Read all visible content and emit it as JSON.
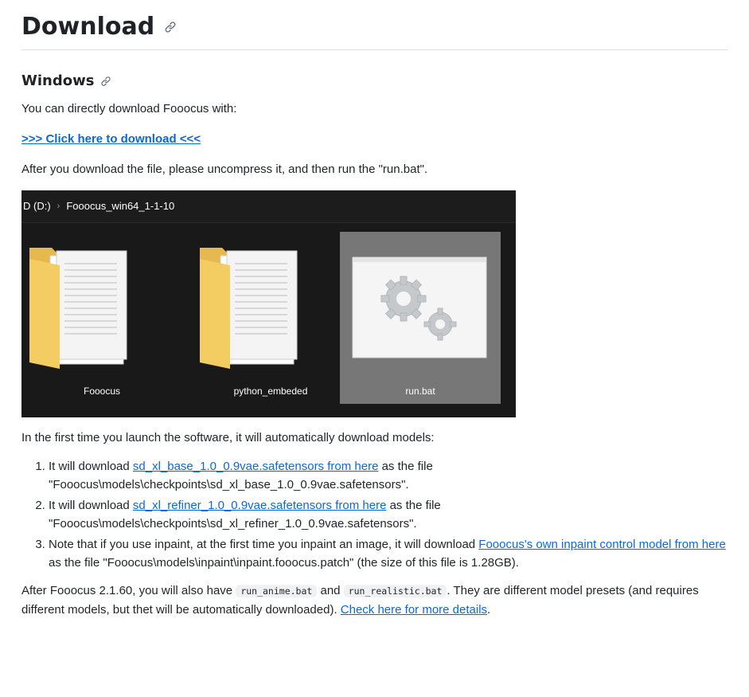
{
  "heading": {
    "title": "Download"
  },
  "windows": {
    "title": "Windows"
  },
  "intro": "You can directly download Fooocus with:",
  "download_link": ">>> Click here to download <<<",
  "after_download": "After you download the file, please uncompress it, and then run the \"run.bat\".",
  "explorer": {
    "drive": "D (D:)",
    "separator": "›",
    "folder": "Fooocus_win64_1-1-10",
    "items": [
      {
        "label": "Fooocus",
        "icon": "folder-icon"
      },
      {
        "label": "python_embeded",
        "icon": "folder-icon"
      },
      {
        "label": "run.bat",
        "icon": "batch-file-icon"
      }
    ]
  },
  "first_time": "In the first time you launch the software, it will automatically download models:",
  "steps": [
    {
      "pre": "It will download ",
      "link": "sd_xl_base_1.0_0.9vae.safetensors from here",
      "post": " as the file \"Fooocus\\models\\checkpoints\\sd_xl_base_1.0_0.9vae.safetensors\"."
    },
    {
      "pre": "It will download ",
      "link": "sd_xl_refiner_1.0_0.9vae.safetensors from here",
      "post": " as the file \"Fooocus\\models\\checkpoints\\sd_xl_refiner_1.0_0.9vae.safetensors\"."
    },
    {
      "pre": "Note that if you use inpaint, at the first time you inpaint an image, it will download ",
      "link": "Fooocus's own inpaint control model from here",
      "post": " as the file \"Fooocus\\models\\inpaint\\inpaint.fooocus.patch\" (the size of this file is 1.28GB)."
    }
  ],
  "presets": {
    "pre": "After Fooocus 2.1.60, you will also have ",
    "code1": "run_anime.bat",
    "mid": " and ",
    "code2": "run_realistic.bat",
    "post": ". They are different model presets (and requires different models, but thet will be automatically downloaded). ",
    "link": "Check here for more details",
    "end": "."
  },
  "colors": {
    "link": "#0969da",
    "text": "#1f2328",
    "explorer_bg": "#191919",
    "selected_tile": "#777777"
  }
}
